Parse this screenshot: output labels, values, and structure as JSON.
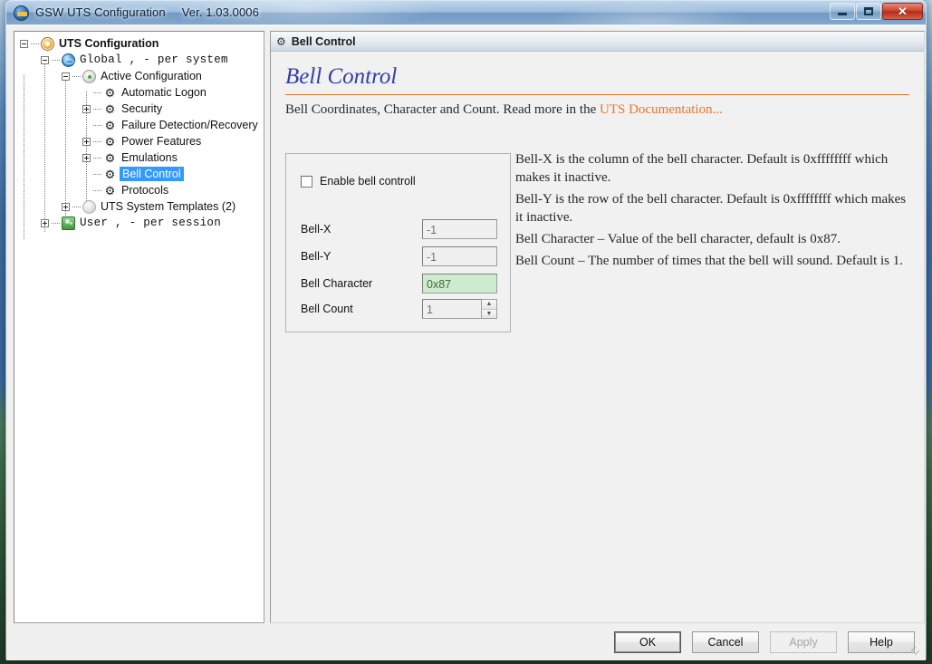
{
  "window": {
    "app_icon": "gsw-logo-icon",
    "title": "GSW UTS Configuration",
    "version": "Ver. 1.03.0006",
    "minimize_label": "Minimize",
    "maximize_label": "Maximize",
    "close_label": "✕"
  },
  "tree": {
    "nodes": [
      {
        "label": "UTS Configuration",
        "icon": "gold-gear-icon",
        "expander": "minus",
        "depth": 0,
        "style": "bold",
        "selected": false
      },
      {
        "label": "Global ,  - per system",
        "icon": "globe-icon",
        "expander": "minus",
        "depth": 1,
        "style": "mono",
        "selected": false
      },
      {
        "label": "Active Configuration",
        "icon": "active-gear-icon",
        "expander": "minus",
        "depth": 2,
        "style": "normal",
        "selected": false
      },
      {
        "label": "Automatic Logon",
        "icon": "dark-gear-icon",
        "expander": "none",
        "depth": 3,
        "style": "normal",
        "selected": false
      },
      {
        "label": "Security",
        "icon": "dark-gear-icon",
        "expander": "plus",
        "depth": 3,
        "style": "normal",
        "selected": false
      },
      {
        "label": "Failure Detection/Recovery",
        "icon": "dark-gear-icon",
        "expander": "none",
        "depth": 3,
        "style": "normal",
        "selected": false
      },
      {
        "label": "Power Features",
        "icon": "dark-gear-icon",
        "expander": "plus",
        "depth": 3,
        "style": "normal",
        "selected": false
      },
      {
        "label": "Emulations",
        "icon": "dark-gear-icon",
        "expander": "plus",
        "depth": 3,
        "style": "normal",
        "selected": false
      },
      {
        "label": "Bell Control",
        "icon": "dark-gear-icon",
        "expander": "none",
        "depth": 3,
        "style": "normal",
        "selected": true
      },
      {
        "label": "Protocols",
        "icon": "dark-gear-icon",
        "expander": "none",
        "depth": 3,
        "style": "normal",
        "selected": false
      },
      {
        "label": "UTS System Templates (2)",
        "icon": "grey-gear-icon",
        "expander": "plus",
        "depth": 2,
        "style": "normal",
        "selected": false
      },
      {
        "label": "User ,   - per session",
        "icon": "users-icon",
        "expander": "plus",
        "depth": 1,
        "style": "mono",
        "selected": false
      }
    ]
  },
  "panel": {
    "header_icon": "gear-icon",
    "header_title": "Bell Control",
    "page_title": "Bell Control",
    "subtitle_text": "Bell Coordinates, Character and Count. Read more in the ",
    "subtitle_link": "UTS Documentation...",
    "accent_rule_color": "#e8762a",
    "title_color": "#2f3fa8"
  },
  "form": {
    "checkbox_label": "Enable bell controll",
    "checkbox_checked": false,
    "fields": [
      {
        "label": "Bell-X",
        "value": "-1",
        "highlight": false,
        "spinner": false
      },
      {
        "label": "Bell-Y",
        "value": "-1",
        "highlight": false,
        "spinner": false
      },
      {
        "label": "Bell Character",
        "value": "0x87",
        "highlight": true,
        "spinner": false
      },
      {
        "label": "Bell Count",
        "value": "1",
        "highlight": false,
        "spinner": true
      }
    ],
    "spinner_up": "▲",
    "spinner_down": "▼",
    "highlight_color": "#cdeccd"
  },
  "description": {
    "paragraphs": [
      "Bell-X is the column of the bell character. Default is 0xffffffff which makes it inactive.",
      "Bell-Y is the row of the bell character. Default is 0xffffffff which makes it inactive.",
      "Bell Character – Value of the bell character, default is 0x87.",
      "Bell Count – The number of times that the bell will sound. Default is 1."
    ]
  },
  "buttons": {
    "ok": "OK",
    "cancel": "Cancel",
    "apply": "Apply",
    "apply_disabled": true,
    "help": "Help"
  }
}
